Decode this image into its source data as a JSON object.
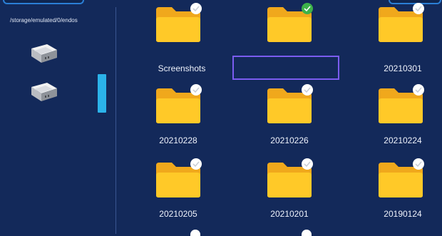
{
  "sidebar": {
    "path": "/storage/emulated/0/endos",
    "drives": [
      {
        "icon": "drive-icon"
      },
      {
        "icon": "drive-icon"
      }
    ]
  },
  "folders": [
    {
      "label": "Screenshots",
      "check": "white"
    },
    {
      "label": "",
      "check": "green"
    },
    {
      "label": "20210301",
      "check": "white"
    },
    {
      "label": "20210228",
      "check": "white"
    },
    {
      "label": "20210226",
      "check": "white"
    },
    {
      "label": "20210224",
      "check": "white"
    },
    {
      "label": "20210205",
      "check": "white"
    },
    {
      "label": "20210201",
      "check": "white"
    },
    {
      "label": "20190124",
      "check": "white"
    }
  ],
  "colors": {
    "background": "#13295a",
    "folder_back": "#f0a81c",
    "folder_front": "#ffc928",
    "selection": "#7b5cf0",
    "scrollbar": "#2bb3ea",
    "check_green": "#3db24a"
  }
}
